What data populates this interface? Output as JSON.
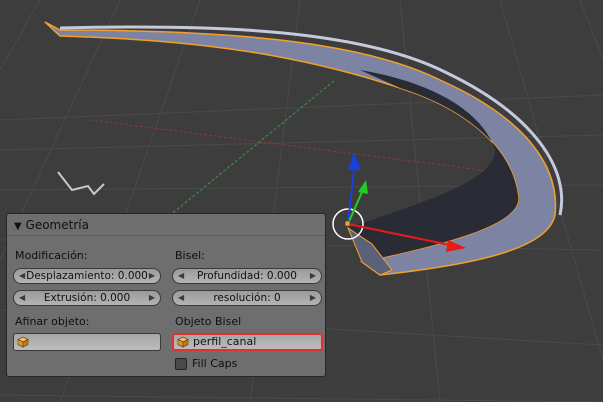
{
  "panel": {
    "title": "Geometría",
    "modificacion_label": "Modificación:",
    "desplazamiento": "Desplazamiento: 0.000",
    "extrusion": "Extrusión: 0.000",
    "bisel_label": "Bisel:",
    "profundidad": "Profundidad: 0.000",
    "resolucion": "resolución: 0",
    "afinar_label": "Afinar objeto:",
    "afinar_value": "",
    "objeto_bisel_label": "Objeto Bisel",
    "objeto_bisel_value": "perfil_canal",
    "fill_caps_label": "Fill Caps",
    "fill_caps_checked": false
  },
  "icons": [
    "disclosure-triangle-icon",
    "mesh-cube-icon",
    "transform-gizmo-icon"
  ],
  "colors": {
    "viewport_bg": "#3d3d3d",
    "panel_bg": "#707070",
    "selection_outline": "#f3a02a",
    "active_field_border": "#e03030",
    "axis_x": "#e81b1b",
    "axis_y": "#22cc22",
    "axis_z": "#1a3fe0",
    "mesh_fill": "#7d84a3"
  }
}
